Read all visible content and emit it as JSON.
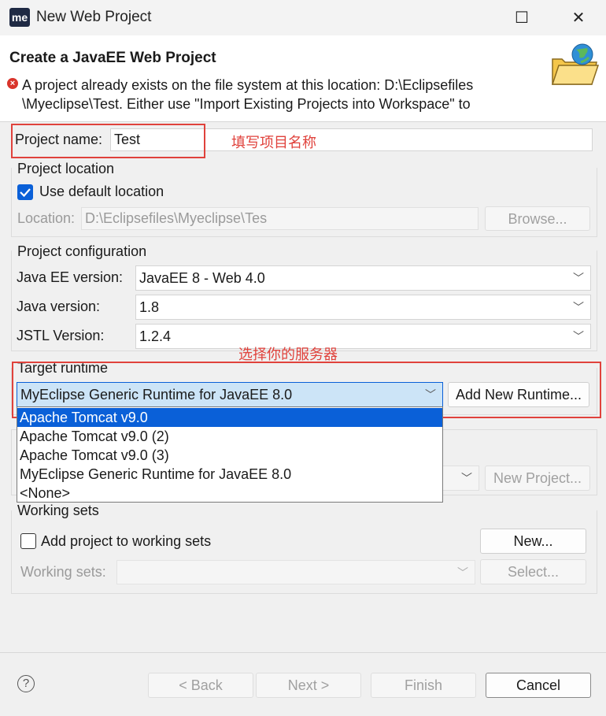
{
  "window": {
    "app_icon": "me",
    "title": "New Web Project",
    "maximize_glyph": "☐",
    "close_glyph": "✕"
  },
  "header": {
    "heading": "Create a JavaEE Web Project",
    "error_line1": "A project already exists on the file system at this location: D:\\Eclipsefiles",
    "error_line2": "\\Myeclipse\\Test.  Either use \"Import Existing Projects into Workspace\" to",
    "error_icon": "error-icon",
    "banner_icon": "web-project-folder-icon"
  },
  "project_name": {
    "label": "Project name:",
    "value": "Test",
    "annotation": "填写项目名称"
  },
  "project_location": {
    "legend": "Project location",
    "use_default_label": "Use default location",
    "use_default_checked": true,
    "location_label": "Location:",
    "location_value": "D:\\Eclipsefiles\\Myeclipse\\Tes",
    "browse_label": "Browse..."
  },
  "project_configuration": {
    "legend": "Project configuration",
    "javaee_label": "Java EE version:",
    "javaee_value": "JavaEE 8 - Web 4.0",
    "java_label": "Java version:",
    "java_value": "1.8",
    "jstl_label": "JSTL Version:",
    "jstl_value": "1.2.4"
  },
  "target_runtime": {
    "annotation": "选择你的服务器",
    "legend": "Target runtime",
    "selected": "MyEclipse Generic Runtime for JavaEE 8.0",
    "add_button": "Add New Runtime...",
    "options": [
      "Apache Tomcat v9.0",
      "Apache Tomcat v9.0 (2)",
      "Apache Tomcat v9.0 (3)",
      "MyEclipse Generic Runtime for JavaEE 8.0",
      "<None>"
    ],
    "highlighted_index": 0
  },
  "ear": {
    "new_project_button": "New Project..."
  },
  "working_sets": {
    "legend": "Working sets",
    "add_label": "Add project to working sets",
    "add_checked": false,
    "new_button": "New...",
    "sets_label": "Working sets:",
    "select_button": "Select..."
  },
  "footer": {
    "help_glyph": "?",
    "back": "< Back",
    "next": "Next >",
    "finish": "Finish",
    "cancel": "Cancel"
  },
  "colors": {
    "accent": "#0a60d8",
    "annotation_red": "#e0423c",
    "error_red": "#d9342b"
  }
}
